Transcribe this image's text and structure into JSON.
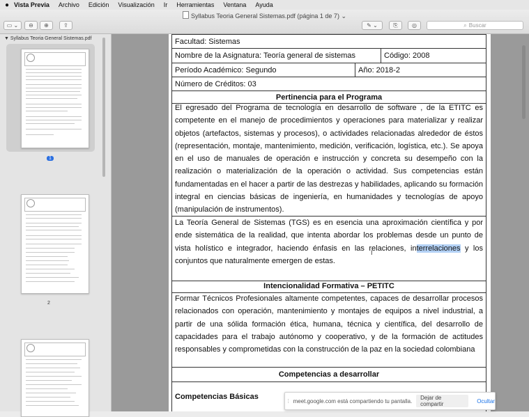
{
  "menu": {
    "apple": "",
    "items": [
      "Vista Previa",
      "Archivo",
      "Edición",
      "Visualización",
      "Ir",
      "Herramientas",
      "Ventana",
      "Ayuda"
    ]
  },
  "window": {
    "title": "Syllabus Teoria General  Sistemas.pdf (página 1 de 7)",
    "search_placeholder": "Buscar"
  },
  "sidebar": {
    "doc_name": "Syllabus Teoria General  Sistemas.pdf",
    "pages": [
      "1",
      "2"
    ]
  },
  "document": {
    "facultad": "Facultad: Sistemas",
    "asignatura": "Nombre de la Asignatura: Teoría general de sistemas",
    "codigo": "Código: 2008",
    "periodo": "Período Académico: Segundo",
    "anio": "Año: 2018-2",
    "creditos": "Número de Créditos: 03",
    "pertinencia_title": "Pertinencia para el Programa",
    "pertinencia_text": "El egresado del Programa de tecnología en desarrollo de software  , de la  ETITC es competente en el manejo de procedimientos y operaciones para materializar y realizar objetos (artefactos, sistemas y procesos), o actividades relacionadas alrededor de éstos (representación, montaje, mantenimiento, medición, verificación, logística, etc.). Se apoya en el uso de manuales de operación e instrucción y concreta su desempeño con la realización o materialización de la operación o actividad. Sus competencias están fundamentadas en el hacer a partir de las destrezas y habilidades, aplicando su formación integral en ciencias básicas de ingeniería, en humanidades y tecnologías de apoyo (manipulación de instrumentos).",
    "tgs_text_before": "La Teoría General de Sistemas (TGS) es en esencia una aproximación científica y por ende sistemática de la realidad, que intenta abordar los problemas desde un punto de vista holístico e integrador, haciendo énfasis en las relaciones, in",
    "tgs_text_highlight": "terrelaciones",
    "tgs_text_after": " y los conjuntos que naturalmente emergen de estas.",
    "intencionalidad_title": "Intencionalidad Formativa – PETITC",
    "intencionalidad_text": "Formar Técnicos Profesionales altamente competentes, capaces de desarrollar procesos relacionados con operación, mantenimiento y montajes de equipos a nivel industrial, a partir de una sólida formación ética, humana, técnica y científica, del desarrollo de capacidades para el trabajo autónomo y cooperativo, y de la formación de actitudes responsables y comprometidas con la construcción de la paz en la sociedad colombiana",
    "competencias_title": "Competencias a desarrollar",
    "competencias_basicas": "Competencias Básicas"
  },
  "share_bar": {
    "message": "meet.google.com está compartiendo tu pantalla.",
    "stop_label": "Dejar de compartir",
    "hide_label": "Ocultar"
  }
}
